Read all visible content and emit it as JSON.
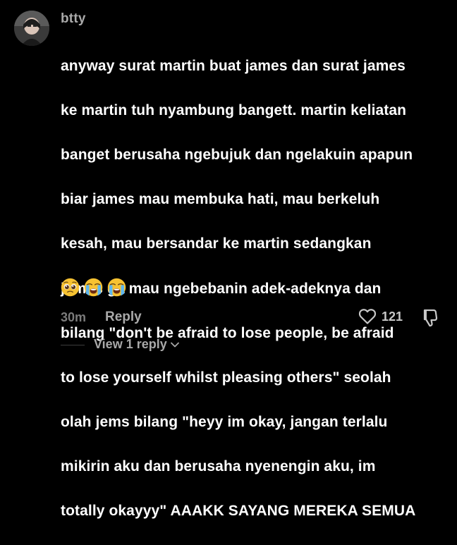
{
  "comment": {
    "username": "btty",
    "text_lines": [
      "anyway surat martin buat james dan surat james",
      "ke martin tuh nyambung bangett. martin keliatan",
      "banget berusaha ngebujuk dan ngelakuin apapun",
      "biar james mau membuka hati, mau berkeluh",
      "kesah, mau bersandar ke martin sedangkan",
      "james ga mau ngebebanin adek-adeknya dan",
      "bilang \"don't be afraid to lose people, be afraid",
      "to lose yourself whilst pleasing others\" seolah",
      "olah jems bilang \"heyy im okay, jangan terlalu",
      "mikirin aku dan berusaha nyenengin aku, im",
      "totally okayyy\" AAAKK SAYANG MEREKA SEMUA"
    ],
    "emojis": [
      "pleading-face",
      "loudly-crying-face",
      "loudly-crying-face"
    ],
    "timestamp": "30m",
    "reply_label": "Reply",
    "like_count": "121",
    "view_replies_label": "View 1 reply"
  },
  "icons": {
    "like": "heart-outline-icon",
    "dislike": "thumbs-down-outline-icon",
    "expand": "chevron-down-icon"
  },
  "colors": {
    "background": "#000000",
    "username": "#a9a9a9",
    "body_text": "#ffffff",
    "secondary_text": "#7b7b7b",
    "emoji_yellow": "#f7c232"
  }
}
